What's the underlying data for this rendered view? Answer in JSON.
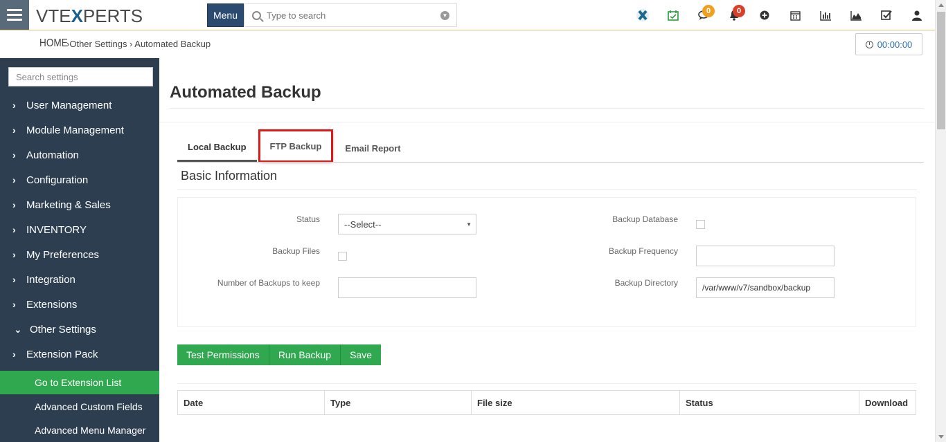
{
  "header": {
    "logo_prefix": "VTE",
    "logo_x": "X",
    "logo_suffix": "PERTS",
    "menu_label": "Menu",
    "search_placeholder": "Type to search",
    "chat_badge": "0",
    "notification_badge": "0"
  },
  "breadcrumb": {
    "home": "HOME",
    "path": "Other Settings ›  Automated Backup",
    "separator": "›"
  },
  "timer": {
    "value": "00:00:00"
  },
  "sidebar": {
    "search_placeholder": "Search settings",
    "items": [
      {
        "label": "User Management",
        "chevron": "›"
      },
      {
        "label": "Module Management",
        "chevron": "›"
      },
      {
        "label": "Automation",
        "chevron": "›"
      },
      {
        "label": "Configuration",
        "chevron": "›"
      },
      {
        "label": "Marketing & Sales",
        "chevron": "›"
      },
      {
        "label": "INVENTORY",
        "chevron": "›"
      },
      {
        "label": "My Preferences",
        "chevron": "›"
      },
      {
        "label": "Integration",
        "chevron": "›"
      },
      {
        "label": "Extensions",
        "chevron": "›"
      },
      {
        "label": "Other Settings",
        "chevron": "⌄"
      },
      {
        "label": "Extension Pack",
        "chevron": "›"
      }
    ],
    "sub_items": [
      {
        "label": "Go to Extension List"
      },
      {
        "label": "Advanced Custom Fields"
      },
      {
        "label": "Advanced Menu Manager"
      }
    ]
  },
  "page": {
    "title": "Automated Backup",
    "tabs": [
      {
        "label": "Local Backup"
      },
      {
        "label": "FTP Backup"
      },
      {
        "label": "Email Report"
      }
    ],
    "section_title": "Basic Information",
    "form": {
      "status_label": "Status",
      "status_value": "--Select--",
      "backup_files_label": "Backup Files",
      "num_backups_label": "Number of Backups to keep",
      "num_backups_value": "",
      "backup_database_label": "Backup Database",
      "backup_frequency_label": "Backup Frequency",
      "backup_frequency_value": "",
      "backup_directory_label": "Backup Directory",
      "backup_directory_value": "/var/www/v7/sandbox/backup"
    },
    "buttons": {
      "test_permissions": "Test Permissions",
      "run_backup": "Run Backup",
      "save": "Save"
    },
    "table": {
      "columns": [
        "Date",
        "Type",
        "File size",
        "Status",
        "Download"
      ]
    }
  },
  "colors": {
    "sidebar_bg": "#2c3e50",
    "accent_green": "#2fa84f",
    "menu_blue": "#2b4a70",
    "highlight_red": "#e01818",
    "badge_orange": "#f0a020",
    "badge_red": "#d9402a"
  }
}
